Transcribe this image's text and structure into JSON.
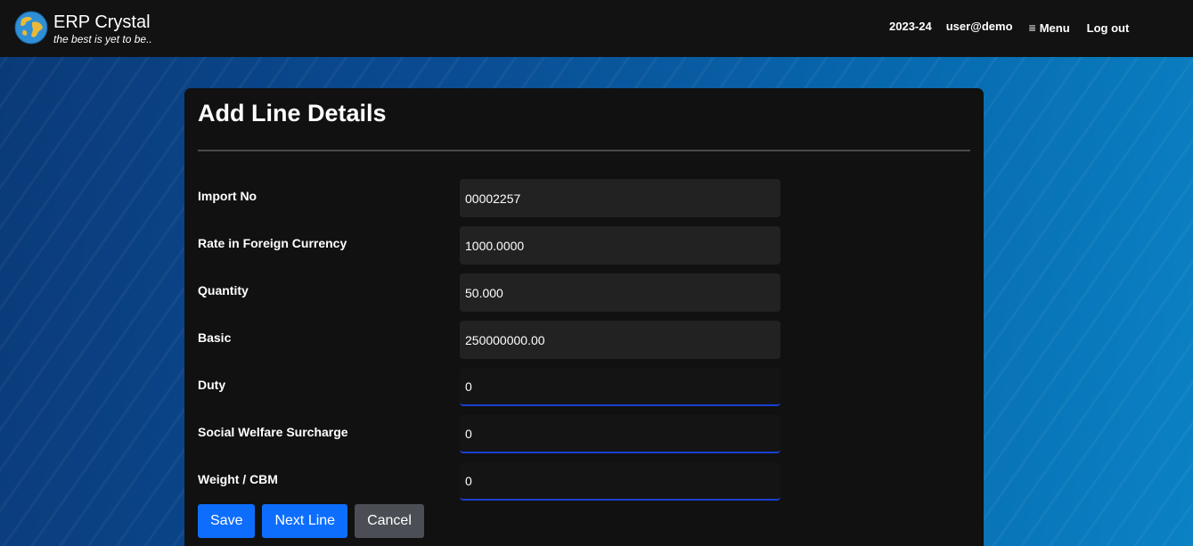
{
  "app": {
    "name": "ERP Crystal",
    "tagline": "the best is yet to be.."
  },
  "nav": {
    "year": "2023-24",
    "user": "user@demo",
    "menu_icon": "≡",
    "menu_label": "Menu",
    "logout_label": "Log out"
  },
  "form": {
    "title": "Add Line Details",
    "fields": [
      {
        "label": "Import No",
        "value": "00002257",
        "editable": false
      },
      {
        "label": "Rate in Foreign Currency",
        "value": "1000.0000",
        "editable": false
      },
      {
        "label": "Quantity",
        "value": "50.000",
        "editable": false
      },
      {
        "label": "Basic",
        "value": "250000000.00",
        "editable": false
      },
      {
        "label": "Duty",
        "value": "0",
        "editable": true
      },
      {
        "label": "Social Welfare Surcharge",
        "value": "0",
        "editable": true
      },
      {
        "label": "Weight / CBM",
        "value": "0",
        "editable": true
      }
    ],
    "buttons": {
      "save": "Save",
      "next_line": "Next Line",
      "cancel": "Cancel"
    }
  },
  "colors": {
    "primary_button": "#0d6efd",
    "secondary_button": "#4b4f55",
    "topbar": "#121212",
    "card": "#111111",
    "focus_underline": "#1a3fd0"
  }
}
